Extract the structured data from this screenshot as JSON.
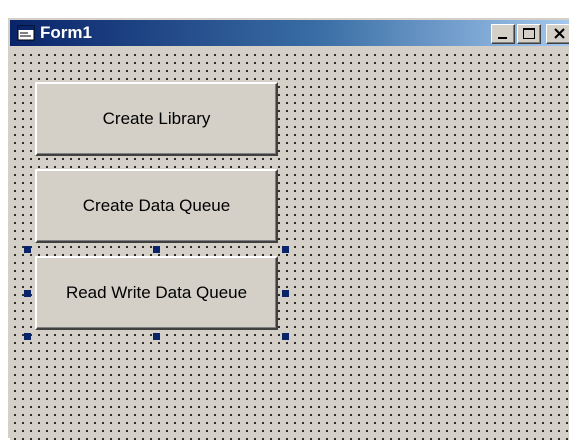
{
  "window": {
    "title": "Form1",
    "title_icon": "form-icon",
    "controls": {
      "minimize_icon": "minimize-icon",
      "maximize_icon": "maximize-icon",
      "close_icon": "close-icon"
    }
  },
  "form": {
    "buttons": [
      {
        "label": "Create Library",
        "selected": false
      },
      {
        "label": "Create Data Queue",
        "selected": false
      },
      {
        "label": "Read Write Data Queue",
        "selected": true
      }
    ],
    "selection_handle_color": "#0a246a",
    "grid": true
  },
  "colors": {
    "face": "#d4d0c8",
    "titlebar_start": "#0a246a",
    "titlebar_end": "#a6caf0"
  }
}
